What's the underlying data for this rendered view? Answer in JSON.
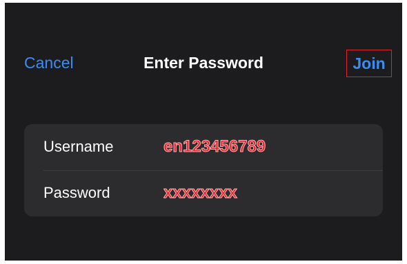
{
  "nav": {
    "cancel_label": "Cancel",
    "title": "Enter Password",
    "join_label": "Join"
  },
  "form": {
    "username": {
      "label": "Username",
      "value": "en123456789"
    },
    "password": {
      "label": "Password",
      "value": "xxxxxxxx"
    }
  },
  "colors": {
    "background": "#1c1c1e",
    "card": "#2c2c2e",
    "accent": "#3a8df5",
    "annotation": "#e0212b"
  }
}
